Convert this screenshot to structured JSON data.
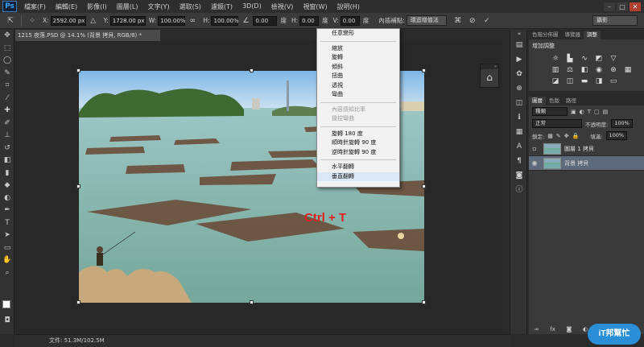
{
  "app": {
    "logo": "Ps"
  },
  "menu": [
    "檔案(F)",
    "編輯(E)",
    "影像(I)",
    "圖層(L)",
    "文字(Y)",
    "選取(S)",
    "濾鏡(T)",
    "3D(D)",
    "檢視(V)",
    "視窗(W)",
    "說明(H)"
  ],
  "options": {
    "x_label": "X:",
    "x_value": "2592.00 px",
    "y_label": "Y:",
    "y_value": "1728.00 px",
    "w_label": "W:",
    "w_value": "100.00%",
    "h_label": "H:",
    "h_value": "100.00%",
    "angle_value": "0.00",
    "angle_unit": "度",
    "hskew_label": "H:",
    "hskew_value": "0.00",
    "hskew_unit": "度",
    "vskew_label": "V:",
    "vskew_value": "0.00",
    "vskew_unit": "度",
    "interp_label": "內插補點:",
    "interp_value": "環迴增值法",
    "workspace": "攝影"
  },
  "document": {
    "tab_title": "1215 夜落.PSD @ 14.1% (背景 拷貝, RGB/8) *",
    "status": "文件: 51.3M/102.5M"
  },
  "overlay_text": "Ctrl + T",
  "context_menu": {
    "groups": [
      [
        {
          "label": "任意變形",
          "disabled": false
        }
      ],
      [
        {
          "label": "縮放",
          "disabled": false
        },
        {
          "label": "旋轉",
          "disabled": false
        },
        {
          "label": "傾斜",
          "disabled": false
        },
        {
          "label": "扭曲",
          "disabled": false
        },
        {
          "label": "透視",
          "disabled": false
        },
        {
          "label": "彎曲",
          "disabled": false
        }
      ],
      [
        {
          "label": "內容感知比率",
          "disabled": true
        },
        {
          "label": "操控彎曲",
          "disabled": true
        }
      ],
      [
        {
          "label": "旋轉 180 度",
          "disabled": false
        },
        {
          "label": "順時針旋轉 90 度",
          "disabled": false
        },
        {
          "label": "逆時針旋轉 90 度",
          "disabled": false
        }
      ],
      [
        {
          "label": "水平翻轉",
          "disabled": false
        },
        {
          "label": "垂直翻轉",
          "disabled": false
        }
      ]
    ]
  },
  "adjust_panel": {
    "tabs": [
      "色階分佈圖",
      "導覽器",
      "調整"
    ],
    "title": "增加調整"
  },
  "layers_panel": {
    "tabs": [
      "圖層",
      "色版",
      "路徑"
    ],
    "filter": "種類",
    "blend_mode": "正常",
    "opacity_label": "不透明度:",
    "opacity_value": "100%",
    "lock_label": "鎖定:",
    "fill_label": "填滿:",
    "fill_value": "100%",
    "layers": [
      {
        "name": "圖層 1 拷貝",
        "visible": false,
        "selected": false
      },
      {
        "name": "背景 拷貝",
        "visible": true,
        "selected": true
      }
    ]
  },
  "watermark": "iT邦幫忙"
}
